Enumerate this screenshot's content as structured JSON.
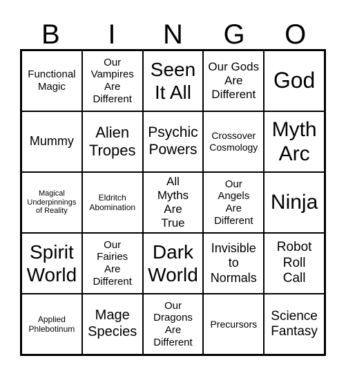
{
  "header": [
    "B",
    "I",
    "N",
    "G",
    "O"
  ],
  "cells": [
    "Functional Magic",
    "Our Vampires Are Different",
    "Seen It All",
    "Our Gods Are Different",
    "God",
    "Mummy",
    "Alien Tropes",
    "Psychic Powers",
    "Crossover Cosmology",
    "Myth Arc",
    "Magical Underpinnings of Reality",
    "Eldritch Abomination",
    "All Myths Are True",
    "Our Angels Are Different",
    "Ninja",
    "Spirit World",
    "Our Fairies Are Different",
    "Dark World",
    "Invisible to Normals",
    "Robot Roll Call",
    "Applied Phlebotinum",
    "Mage Species",
    "Our Dragons Are Different",
    "Precursors",
    "Science Fantasy"
  ]
}
